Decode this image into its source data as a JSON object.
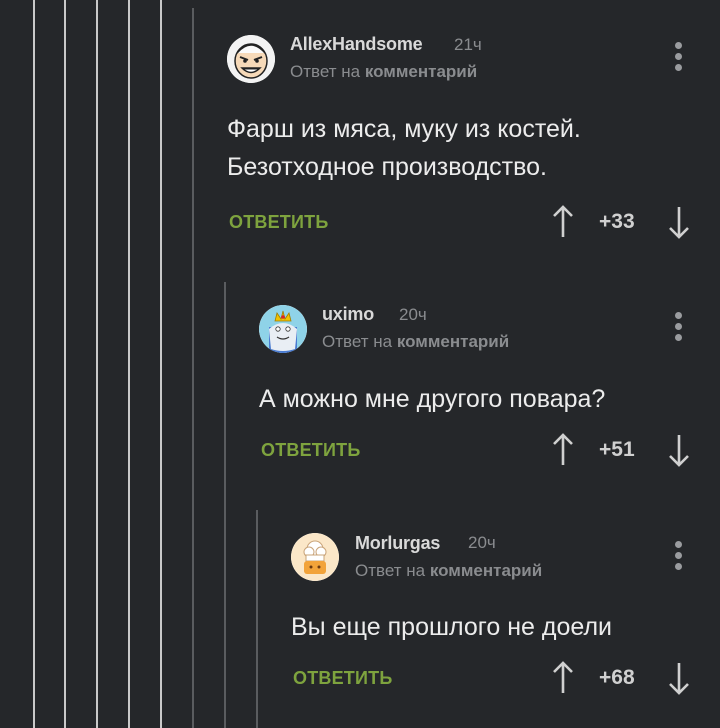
{
  "comments": [
    {
      "author": "AllexHandsome",
      "time": "21ч",
      "reply_prefix": "Ответ на",
      "reply_link": "комментарий",
      "text_lines": [
        "Фарш из мяса, муку из костей.",
        "Безотходное производство."
      ],
      "reply_label": "ОТВЕТИТЬ",
      "rating": "+33",
      "avatar": "smug-face-avatar"
    },
    {
      "author": "uximo",
      "time": "20ч",
      "reply_prefix": "Ответ на",
      "reply_link": "комментарий",
      "text_lines": [
        "А можно мне другого повара?"
      ],
      "reply_label": "ОТВЕТИТЬ",
      "rating": "+51",
      "avatar": "ice-king-avatar"
    },
    {
      "author": "Morlurgas",
      "time": "20ч",
      "reply_prefix": "Ответ на",
      "reply_link": "комментарий",
      "text_lines": [
        "Вы еще прошлого не доели"
      ],
      "reply_label": "ОТВЕТИТЬ",
      "rating": "+68",
      "avatar": "chef-avatar"
    }
  ],
  "colors": {
    "background": "#25272a",
    "reply_button": "#7ea33e",
    "thread_line": "#c9c9c9"
  },
  "icons": [
    "upvote-arrow-icon",
    "downvote-arrow-icon",
    "more-menu-icon"
  ]
}
